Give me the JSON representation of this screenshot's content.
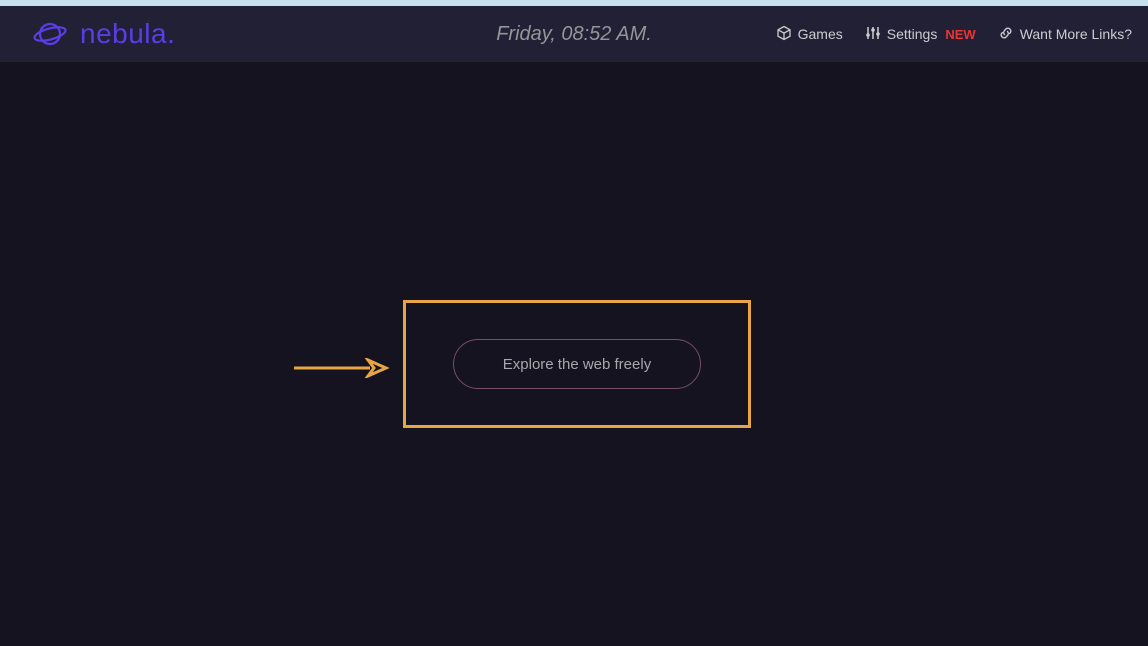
{
  "colors": {
    "accent": "#5b3de8",
    "highlight": "#e8a544",
    "badge": "#e63636"
  },
  "brand": {
    "name": "nebula."
  },
  "header": {
    "datetime": "Friday, 08:52 AM."
  },
  "nav": {
    "games": "Games",
    "settings": "Settings",
    "settings_badge": "NEW",
    "more_links": "Want More Links?"
  },
  "search": {
    "placeholder": "Explore the web freely"
  }
}
